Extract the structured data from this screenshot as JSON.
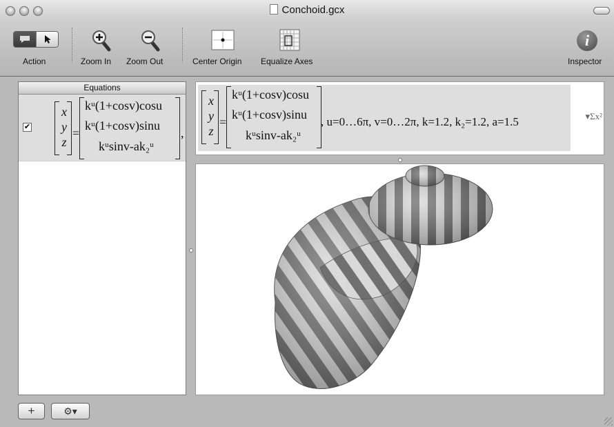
{
  "window": {
    "title": "Conchoid.gcx"
  },
  "toolbar": {
    "action_label": "Action",
    "zoom_in_label": "Zoom In",
    "zoom_out_label": "Zoom Out",
    "center_origin_label": "Center Origin",
    "equalize_axes_label": "Equalize Axes",
    "inspector_label": "Inspector",
    "inspector_glyph": "i"
  },
  "sidebar": {
    "header": "Equations",
    "equation_checked": true,
    "check_glyph": "✔",
    "vector": [
      "x",
      "y",
      "z"
    ],
    "components": [
      "kᵘ(1+cosv)cosu",
      "kᵘ(1+cosv)sinu",
      "kᵘsinv-ak₂ᵘ"
    ],
    "trailing": ", u"
  },
  "equation_bar": {
    "params": ", u=0…6π, v=0…2π, k=1.2, k₂=1.2, a=1.5",
    "sum_icon": "▾Σx²"
  },
  "bottom": {
    "add_glyph": "+",
    "gear_glyph": "⚙▾"
  },
  "icons": {
    "action-mode": "speech-bubble-icon",
    "arrow": "pointer-icon",
    "zoom-in": "magnifier-plus-icon",
    "zoom-out": "magnifier-minus-icon",
    "center-origin": "crosshair-icon",
    "equalize-axes": "grid-icon",
    "inspector": "info-icon"
  },
  "colors": {
    "stripe_dark": "#6e6e6e",
    "stripe_light": "#d9d9d9",
    "selection": "#dedede"
  }
}
